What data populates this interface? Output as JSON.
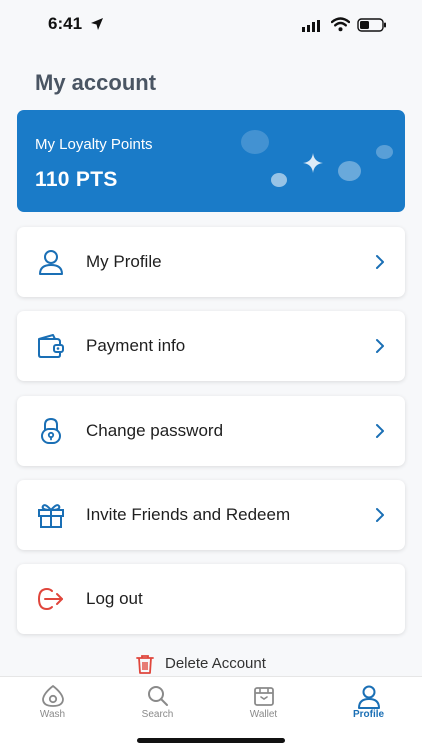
{
  "status_bar": {
    "time": "6:41"
  },
  "header": {
    "title": "My account"
  },
  "loyalty": {
    "label": "My Loyalty Points",
    "points": "110 PTS"
  },
  "menu": {
    "items": [
      {
        "label": "My Profile",
        "icon": "person-icon"
      },
      {
        "label": "Payment info",
        "icon": "wallet-icon"
      },
      {
        "label": "Change password",
        "icon": "lock-icon"
      },
      {
        "label": "Invite Friends and Redeem",
        "icon": "gift-icon"
      },
      {
        "label": "Log out",
        "icon": "logout-icon"
      }
    ]
  },
  "delete_account": {
    "label": "Delete Account"
  },
  "tabs": [
    {
      "label": "Wash",
      "icon": "eye-drop-icon"
    },
    {
      "label": "Search",
      "icon": "search-icon"
    },
    {
      "label": "Wallet",
      "icon": "wallet-tab-icon"
    },
    {
      "label": "Profile",
      "icon": "person-icon"
    }
  ],
  "colors": {
    "accent": "#1a7bc8",
    "active_tab": "#1a6fb5",
    "danger": "#e0463c",
    "title": "#4a5563"
  },
  "active_tab": "Profile"
}
